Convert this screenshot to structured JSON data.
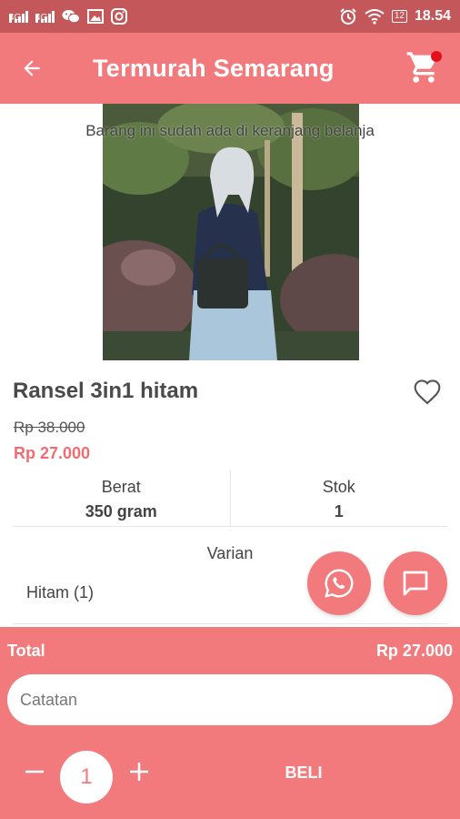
{
  "status_bar": {
    "signal1_label": "4G",
    "signal2_label": "4G",
    "battery": "12",
    "time": "18.54",
    "left_icons": [
      "signal-icon",
      "signal-icon",
      "wechat-icon",
      "image-icon",
      "instagram-icon"
    ],
    "right_icons": [
      "alarm-icon",
      "wifi-icon",
      "battery-icon"
    ]
  },
  "app_bar": {
    "title": "Termurah Semarang",
    "cart_badge_color": "#e3101c"
  },
  "product": {
    "notice": "Barang ini sudah ada di keranjang belanja",
    "name": "Ransel 3in1 hitam",
    "price_old": "Rp 38.000",
    "price_new": "Rp 27.000",
    "specs": [
      {
        "label": "Berat",
        "value": "350 gram"
      },
      {
        "label": "Stok",
        "value": "1"
      }
    ],
    "variant_label": "Varian",
    "variant_value": "Hitam (1)"
  },
  "order": {
    "total_label": "Total",
    "total_value": "Rp 27.000",
    "note_placeholder": "Catatan",
    "quantity": "1",
    "buy_label": "BELI"
  },
  "colors": {
    "accent": "#f27a7d",
    "status_bar": "#c4575a",
    "price": "#ef6d70"
  }
}
